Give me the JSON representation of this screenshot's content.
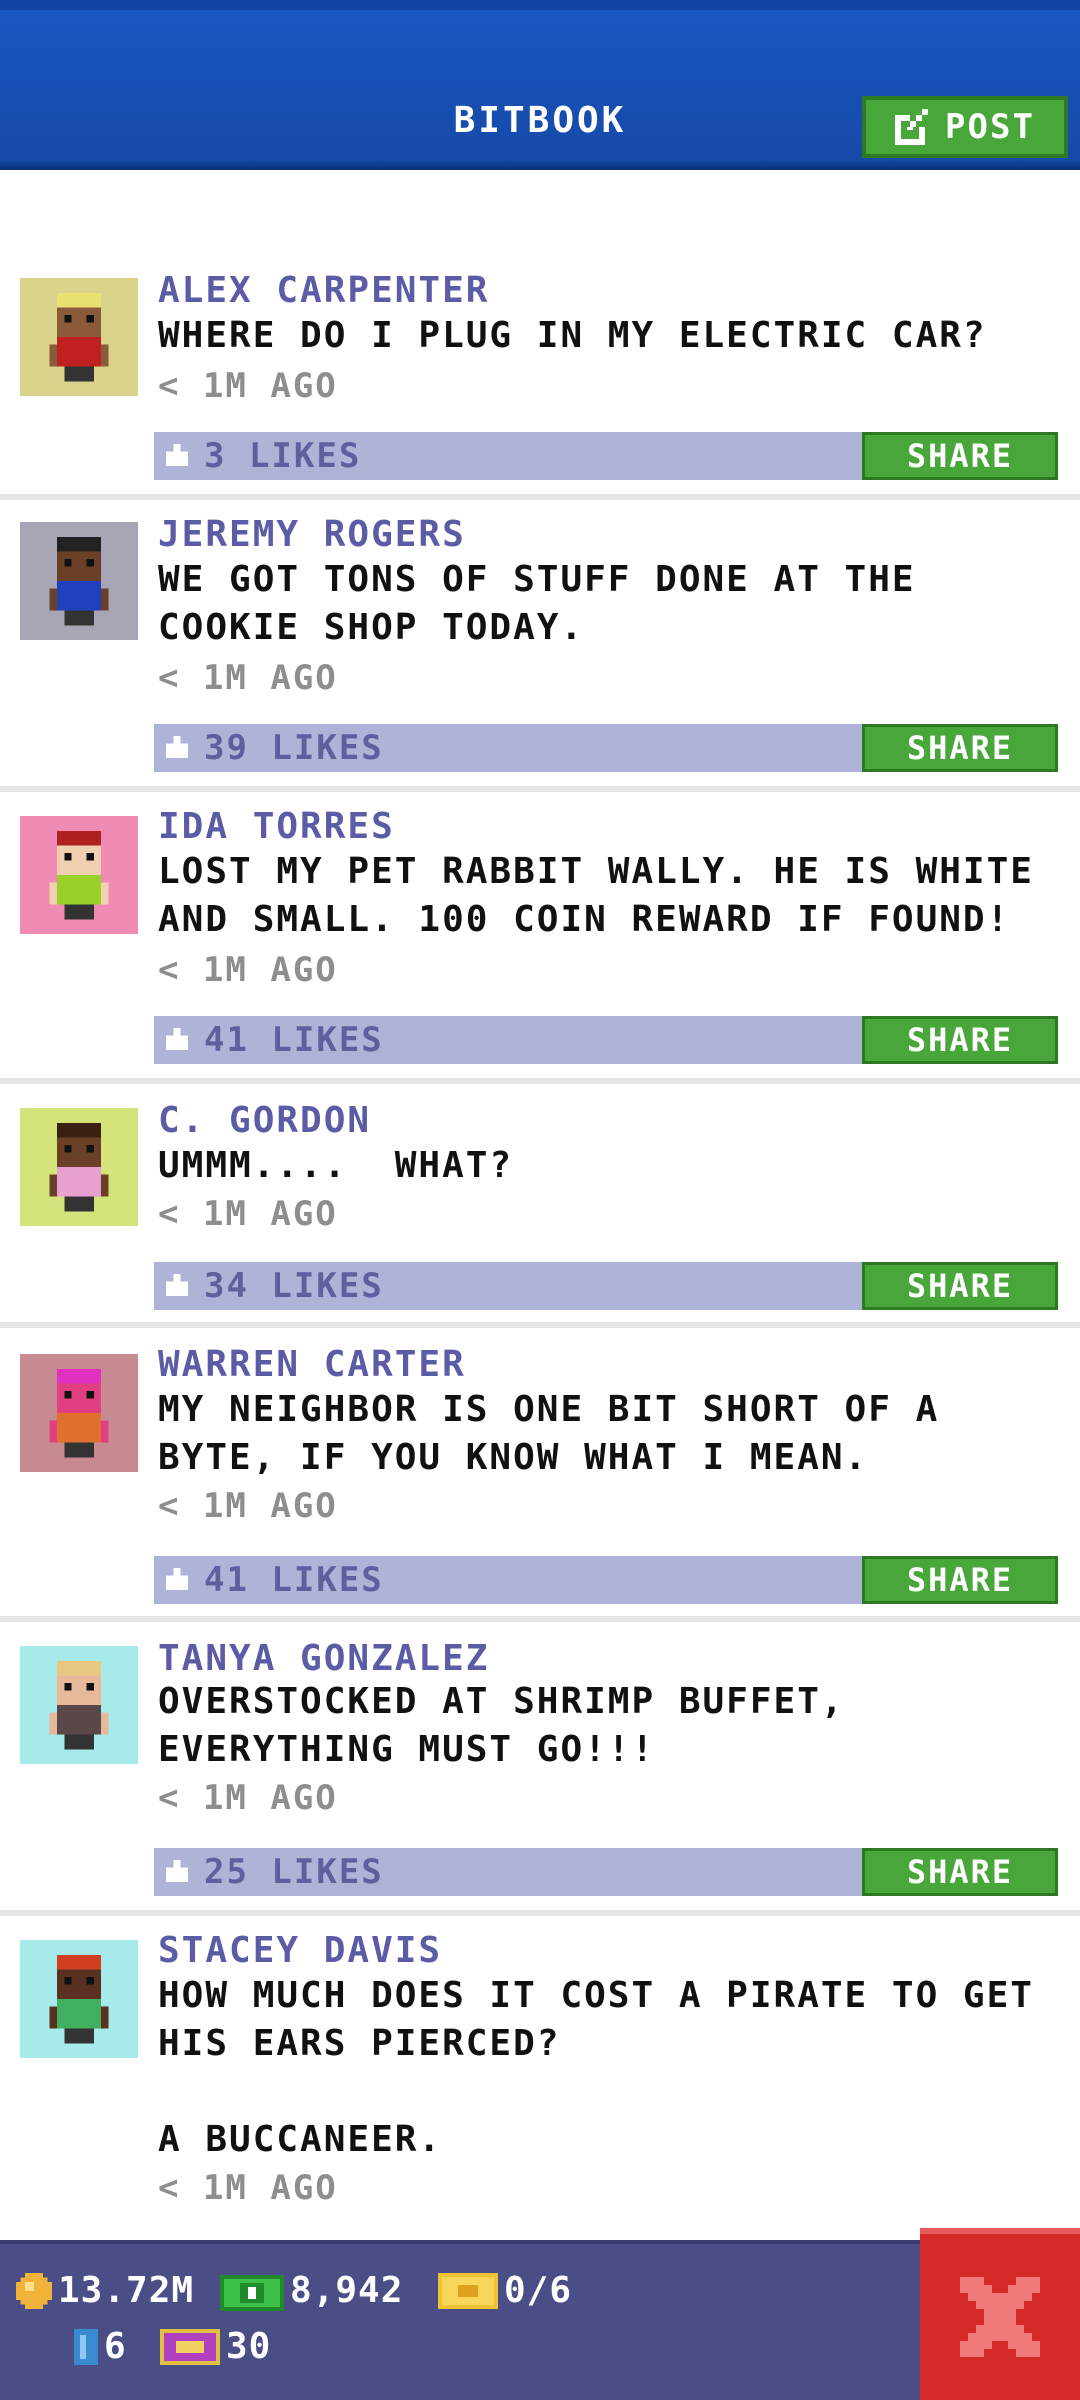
{
  "header": {
    "title": "BITBOOK",
    "post_label": "POST"
  },
  "posts": [
    {
      "name": "ALEX CARPENTER",
      "message": "WHERE DO I PLUG IN MY ELECTRIC CAR?",
      "time": "< 1M AGO",
      "likes": "3 LIKES",
      "share": "SHARE",
      "avatar_bg": "#d8d28a",
      "skin": "#8a5a3a",
      "hair": "#e8e070",
      "shirt": "#c02020"
    },
    {
      "name": "JEREMY ROGERS",
      "message": "WE GOT TONS OF STUFF DONE AT THE COOKIE SHOP TODAY.",
      "time": "< 1M AGO",
      "likes": "39 LIKES",
      "share": "SHARE",
      "avatar_bg": "#a8a6b4",
      "skin": "#6a4028",
      "hair": "#222222",
      "shirt": "#2040c0"
    },
    {
      "name": "IDA TORRES",
      "message": "LOST MY PET RABBIT WALLY. HE IS WHITE AND SMALL. 100 COIN REWARD IF FOUND!",
      "time": "< 1M AGO",
      "likes": "41 LIKES",
      "share": "SHARE",
      "avatar_bg": "#f08cb4",
      "skin": "#f0d0b0",
      "hair": "#b02020",
      "shirt": "#9ad02a"
    },
    {
      "name": "C. GORDON",
      "message": "UMMM....  WHAT?",
      "time": "< 1M AGO",
      "likes": "34 LIKES",
      "share": "SHARE",
      "avatar_bg": "#d4e47a",
      "skin": "#6a4028",
      "hair": "#3a2010",
      "shirt": "#e8a0d0"
    },
    {
      "name": "WARREN CARTER",
      "message": "MY NEIGHBOR IS ONE BIT SHORT OF A BYTE, IF YOU KNOW WHAT I MEAN.",
      "time": "< 1M AGO",
      "likes": "41 LIKES",
      "share": "SHARE",
      "avatar_bg": "#c68a90",
      "skin": "#e04080",
      "hair": "#e030c0",
      "shirt": "#e07030"
    },
    {
      "name": "TANYA GONZALEZ",
      "message": "OVERSTOCKED AT SHRIMP BUFFET, EVERYTHING MUST GO!!!",
      "time": "< 1M AGO",
      "likes": "25 LIKES",
      "share": "SHARE",
      "avatar_bg": "#a6eaea",
      "skin": "#e8b89a",
      "hair": "#e8c880",
      "shirt": "#5a4848"
    },
    {
      "name": "STACEY DAVIS",
      "message": "HOW MUCH DOES IT COST A PIRATE TO GET HIS EARS PIERCED?\n\nA BUCCANEER.",
      "time": "< 1M AGO",
      "likes": "",
      "share": "",
      "avatar_bg": "#a6eaea",
      "skin": "#5a3020",
      "hair": "#d04020",
      "shirt": "#40b060"
    }
  ],
  "bottom": {
    "coins": "13.72M",
    "bux": "8,942",
    "tickets": "0/6",
    "floors": "6",
    "vip": "30"
  },
  "colors": {
    "header": "#1a56c2",
    "green": "#48a63a",
    "likebar": "#b0b3d8",
    "name": "#5b5ba6",
    "bottom": "#4b4d86",
    "close": "#d42a2a"
  },
  "icons": {
    "post": "edit-icon",
    "like": "thumb-icon",
    "coin": "coin-icon",
    "bux": "bux-icon",
    "ticket": "ticket-icon",
    "floor": "floor-icon",
    "vip": "vip-icon",
    "close": "close-icon"
  }
}
